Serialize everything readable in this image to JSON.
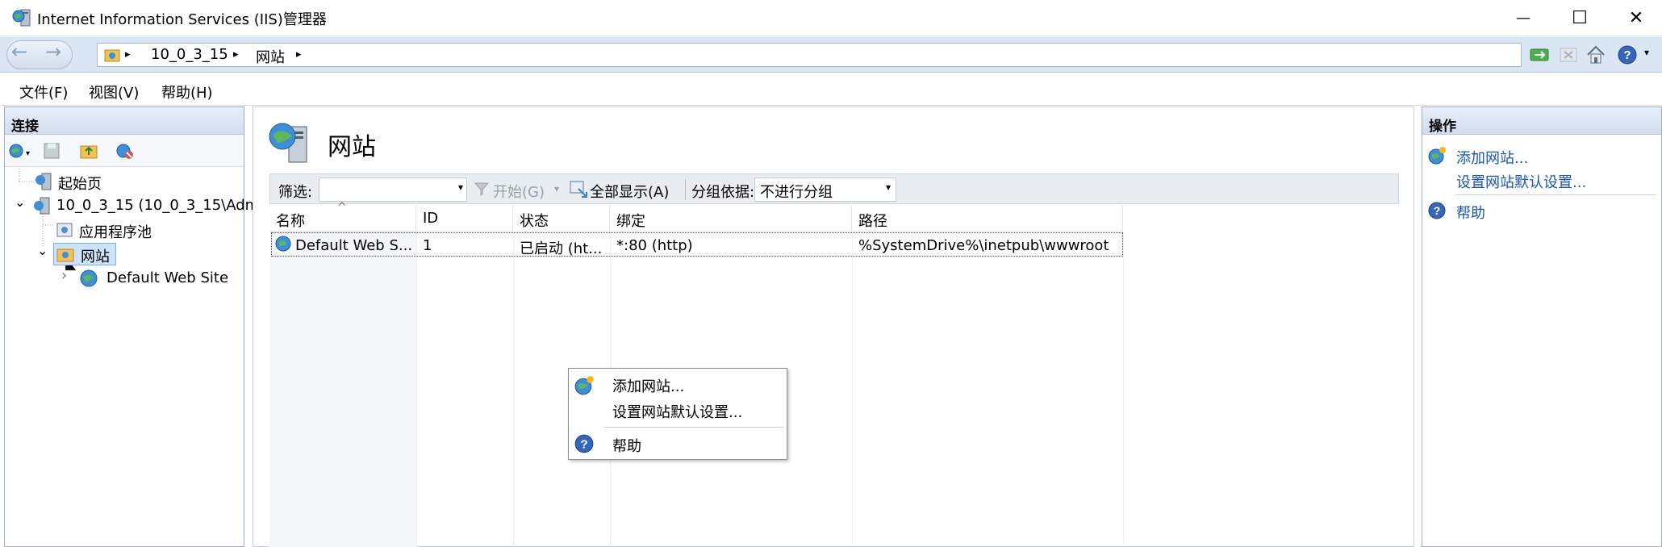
{
  "window": {
    "title": "Internet Information Services (IIS)管理器",
    "minimize_glyph": "—",
    "maximize_glyph": "☐",
    "close_glyph": "✕"
  },
  "address": {
    "segments": [
      "10_0_3_15",
      "网站"
    ],
    "sep_glyph": "▸"
  },
  "menu": [
    "文件(F)",
    "视图(V)",
    "帮助(H)"
  ],
  "connections": {
    "title": "连接",
    "tree": [
      {
        "label": "起始页",
        "icon": "start-page-icon"
      },
      {
        "label": "10_0_3_15 (10_0_3_15\\Adm",
        "icon": "server-icon",
        "expander": "⌄"
      },
      {
        "label": "应用程序池",
        "icon": "app-pool-icon"
      },
      {
        "label": "网站",
        "icon": "sites-folder-icon",
        "expander": "⌄"
      },
      {
        "label": "Default Web Site",
        "icon": "globe-icon",
        "expander": "›"
      }
    ]
  },
  "center": {
    "title": "网站",
    "filter": {
      "label": "筛选:",
      "start": "开始(G)",
      "show_all": "全部显示(A)",
      "group_by": "分组依据:",
      "group_value": "不进行分组",
      "dropdown_glyph": "▾"
    },
    "columns": [
      "名称",
      "ID",
      "状态",
      "绑定",
      "路径"
    ],
    "sort_glyph": "^",
    "rows": [
      {
        "name": "Default Web S...",
        "id": "1",
        "status": "已启动 (ht...",
        "binding": "*:80 (http)",
        "path": "%SystemDrive%\\inetpub\\wwwroot"
      }
    ]
  },
  "actions": {
    "title": "操作",
    "items": [
      "添加网站...",
      "设置网站默认设置...",
      "帮助"
    ]
  },
  "context_menu": {
    "items": [
      "添加网站...",
      "设置网站默认设置...",
      "帮助"
    ]
  },
  "colors": {
    "accent_link": "#1a56b0",
    "header_blue": "#d2deee",
    "address_bar": "#dbe6f4"
  }
}
